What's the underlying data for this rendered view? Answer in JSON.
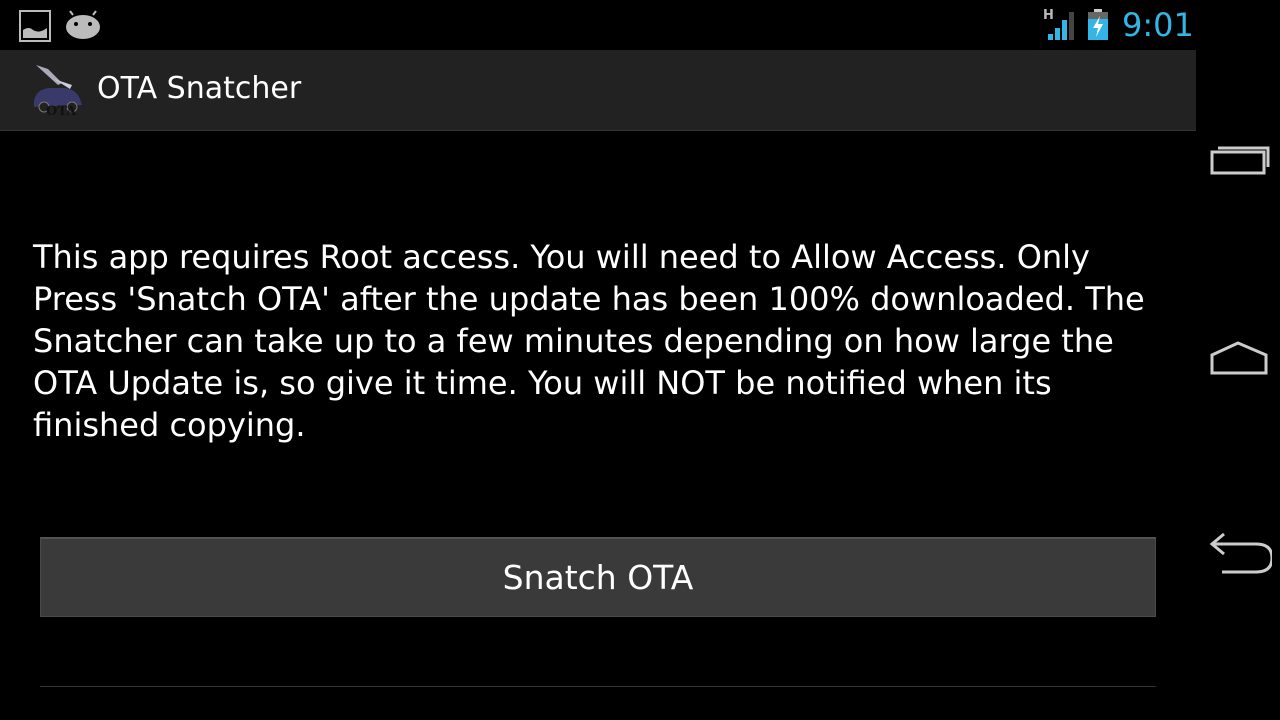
{
  "status_bar": {
    "time": "9:01",
    "network_type": "H",
    "icons": [
      "gallery-icon",
      "android-icon",
      "signal-icon",
      "battery-charging-icon"
    ],
    "accent_color": "#33b5e5"
  },
  "action_bar": {
    "app_icon_text": "OTA",
    "title": "OTA Snatcher"
  },
  "main": {
    "description": "This app requires Root access. You will need to Allow Access. Only Press 'Snatch OTA' after the update has been 100% downloaded. The Snatcher can take up to a few minutes depending on how large the OTA Update is, so give it time. You will NOT be notified when its finished copying.",
    "snatch_button_label": "Snatch OTA"
  },
  "nav_bar": {
    "icons": [
      "recent-apps-icon",
      "home-icon",
      "back-icon"
    ]
  }
}
